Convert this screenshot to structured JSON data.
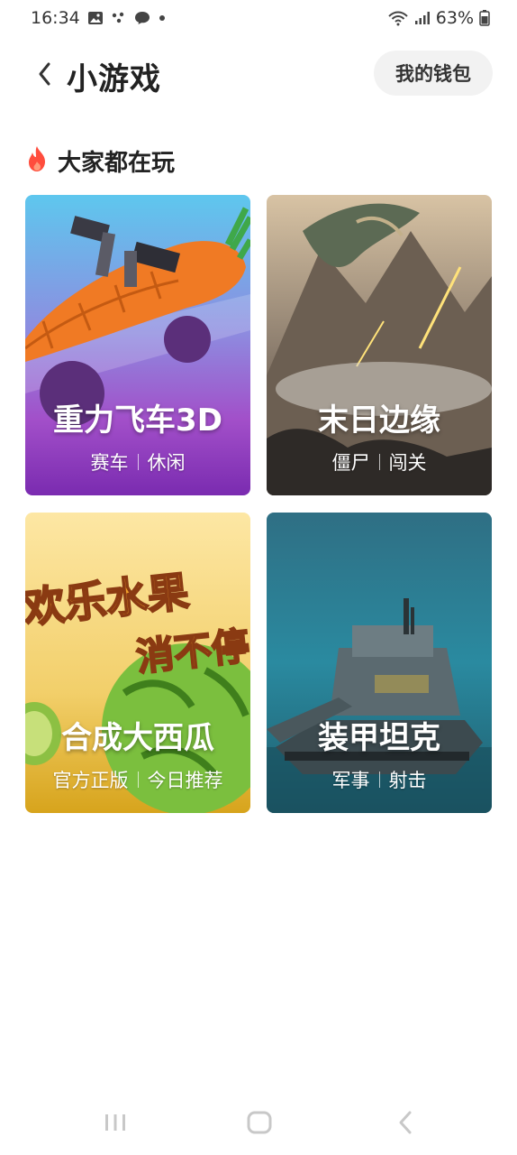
{
  "status_bar": {
    "time": "16:34",
    "battery": "63%",
    "icons": [
      "image-icon",
      "dots-icon",
      "chat-icon",
      "dot-icon",
      "wifi-icon",
      "signal-icon",
      "battery-icon"
    ]
  },
  "header": {
    "title": "小游戏",
    "wallet_label": "我的钱包"
  },
  "section": {
    "title": "大家都在玩",
    "icon": "fire-icon",
    "icon_color": "#ff4d3d"
  },
  "games": [
    {
      "title": "重力飞车3D",
      "tags": [
        "赛车",
        "休闲"
      ]
    },
    {
      "title": "末日边缘",
      "tags": [
        "僵尸",
        "闯关"
      ]
    },
    {
      "title": "合成大西瓜",
      "tags": [
        "官方正版",
        "今日推荐"
      ],
      "art_text_1": "欢乐水果",
      "art_text_2": "消不停"
    },
    {
      "title": "装甲坦克",
      "tags": [
        "军事",
        "射击"
      ]
    }
  ],
  "nav": {
    "icons": [
      "recent-apps-icon",
      "home-icon",
      "back-icon"
    ]
  }
}
